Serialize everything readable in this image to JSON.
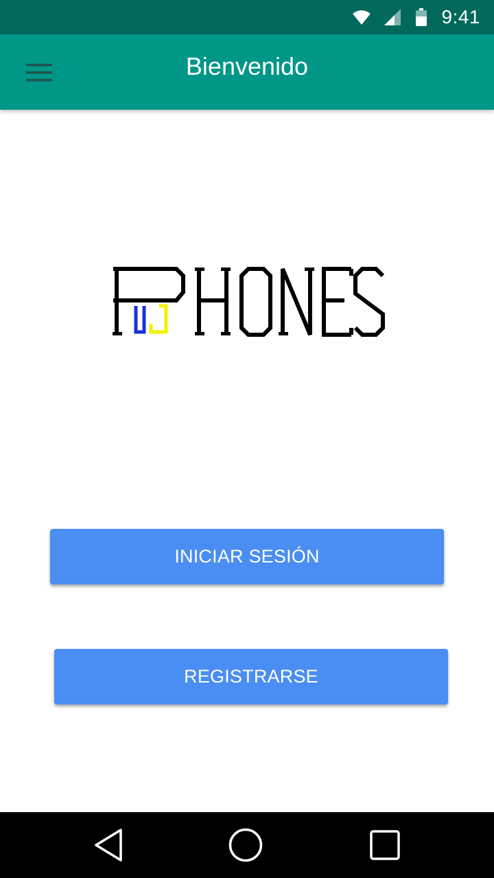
{
  "status_bar": {
    "time": "9:41",
    "icons": [
      "wifi-icon",
      "cell-signal-icon",
      "battery-icon"
    ],
    "background": "#00695c"
  },
  "app_bar": {
    "title": "Bienvenido",
    "menu_icon": "hamburger-menu-icon",
    "background": "#009688"
  },
  "logo": {
    "text": "PUJPHONES",
    "colors": {
      "main": "#000000",
      "u": "#1a2fe0",
      "j": "#f2f200"
    }
  },
  "buttons": {
    "login_label": "INICIAR SESIÓN",
    "register_label": "REGISTRARSE",
    "color": "#4a8df3"
  },
  "nav_bar": {
    "icons": [
      "back-icon",
      "home-icon",
      "recents-icon"
    ]
  }
}
